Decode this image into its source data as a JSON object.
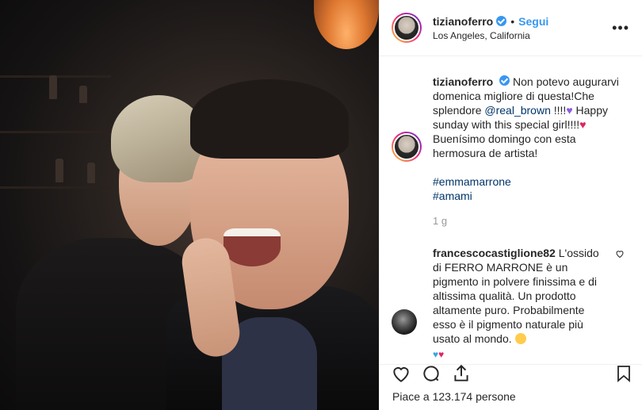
{
  "header": {
    "username": "tizianoferro",
    "dot": "•",
    "follow_label": "Segui",
    "location": "Los Angeles, California",
    "more_label": "•••"
  },
  "caption": {
    "username": "tizianoferro",
    "text_1": "Non potevo augurarvi domenica migliore di questa!Che splendore ",
    "mention": "@real_brown",
    "text_2": " !!!!",
    "heart_purple": "♥",
    "text_3": " Happy sunday with this special girl!!!!",
    "heart_red": "♥",
    "text_4": " Buenísimo domingo con esta hermosura de artista!",
    "tags": [
      "#emmamarrone",
      "#amami"
    ],
    "time": "1 g"
  },
  "comment": {
    "username": "francescocastiglione82",
    "text": "L'ossido di FERRO MARRONE è un pigmento in polvere finissima e di altissima qualità. Un prodotto altamente puro. Probabilmente esso è il pigmento naturale più usato al mondo.",
    "hearts": [
      "♥",
      "♥"
    ]
  },
  "footer": {
    "likes": "Piace a 123.174 persone"
  },
  "colors": {
    "link_blue": "#3897f0",
    "mention_blue": "#003569",
    "verified_blue": "#3897f0"
  }
}
